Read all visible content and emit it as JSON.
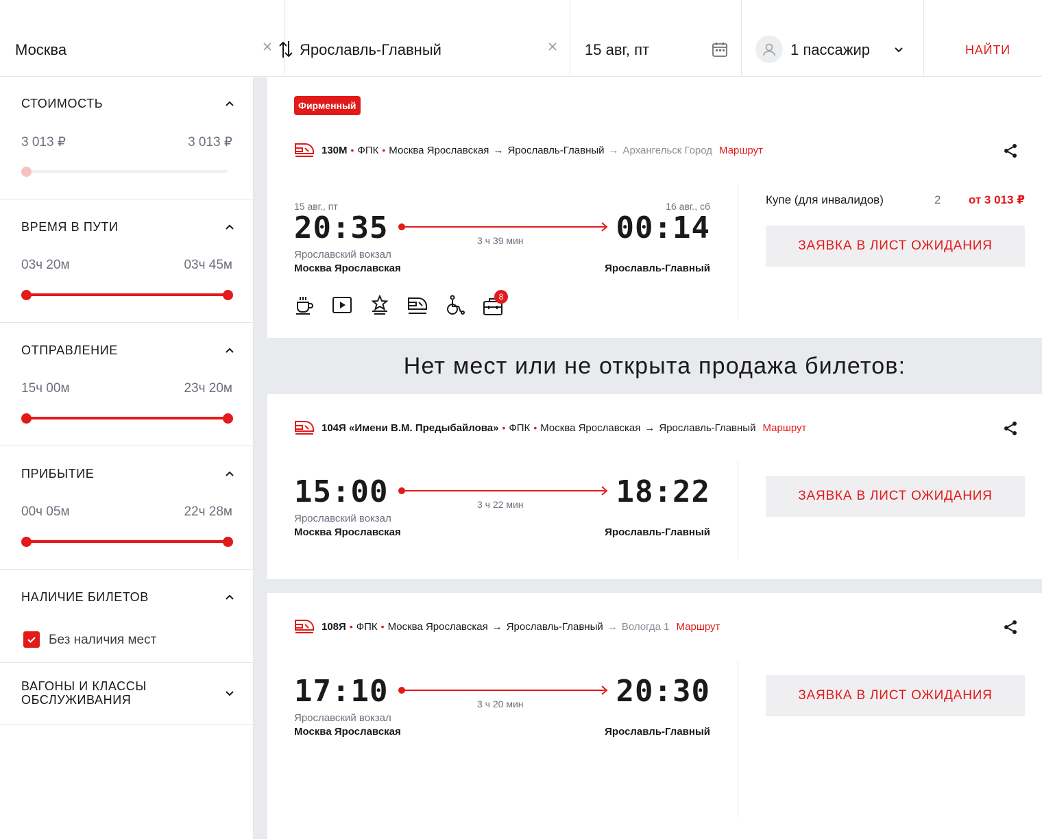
{
  "search": {
    "from": "Москва",
    "to": "Ярославль-Главный",
    "date": "15 авг, пт",
    "passengers": "1 пассажир",
    "find_label": "НАЙТИ"
  },
  "filters": {
    "cost": {
      "title": "СТОИМОСТЬ",
      "min": "3 013 ₽",
      "max": "3 013 ₽"
    },
    "travel_time": {
      "title": "ВРЕМЯ В ПУТИ",
      "min": "03ч 20м",
      "max": "03ч 45м"
    },
    "departure": {
      "title": "ОТПРАВЛЕНИЕ",
      "min": "15ч 00м",
      "max": "23ч 20м"
    },
    "arrival": {
      "title": "ПРИБЫТИЕ",
      "min": "00ч 05м",
      "max": "22ч 28м"
    },
    "availability": {
      "title": "НАЛИЧИЕ БИЛЕТОВ",
      "option": "Без наличия мест",
      "checked": true
    },
    "cars": {
      "title_line1": "ВАГОНЫ И КЛАССЫ",
      "title_line2": "ОБСЛУЖИВАНИЯ"
    }
  },
  "no_seats_message": "Нет мест или не открыта продажа билетов:",
  "trains": [
    {
      "badge": "Фирменный",
      "number": "130М",
      "carrier": "ФПК",
      "from_station": "Москва Ярославская",
      "arrow": "→",
      "to_station": "Ярославль-Главный",
      "extra_arrow": "→",
      "extra_dest": "Архангельск Город",
      "route_link": "Маршрут",
      "dep_date": "15 авг., пт",
      "arr_date": "16 авг., сб",
      "dep_time": "20:35",
      "arr_time": "00:14",
      "duration": "3 ч 39 мин",
      "dep_station_sub": "Ярославский вокзал",
      "dep_station": "Москва Ярославская",
      "arr_station": "Ярославль-Главный",
      "car_class": "Купе (для инвалидов)",
      "seats": "2",
      "price": "от 3 013 ₽",
      "button": "ЗАЯВКА В ЛИСТ ОЖИДАНИЯ",
      "amenities": [
        "coffee-icon",
        "video-icon",
        "award-icon",
        "train-front-icon",
        "wheelchair-icon",
        "luggage-icon"
      ],
      "luggage_badge": "8"
    },
    {
      "number": "104Я «Имени В.М. Предыбайлова»",
      "carrier": "ФПК",
      "from_station": "Москва Ярославская",
      "arrow": "→",
      "to_station": "Ярославль-Главный",
      "route_link": "Маршрут",
      "dep_time": "15:00",
      "arr_time": "18:22",
      "duration": "3 ч 22 мин",
      "dep_station_sub": "Ярославский вокзал",
      "dep_station": "Москва Ярославская",
      "arr_station": "Ярославль-Главный",
      "button": "ЗАЯВКА В ЛИСТ ОЖИДАНИЯ"
    },
    {
      "number": "108Я",
      "carrier": "ФПК",
      "from_station": "Москва Ярославская",
      "arrow": "→",
      "to_station": "Ярославль-Главный",
      "extra_arrow": "→",
      "extra_dest": "Вологда 1",
      "route_link": "Маршрут",
      "dep_time": "17:10",
      "arr_time": "20:30",
      "duration": "3 ч 20 мин",
      "dep_station_sub": "Ярославский вокзал",
      "dep_station": "Москва Ярославская",
      "arr_station": "Ярославль-Главный",
      "button": "ЗАЯВКА В ЛИСТ ОЖИДАНИЯ"
    }
  ],
  "colors": {
    "accent": "#e21a1a",
    "background": "#e9eaee",
    "button_bg": "#efeff1"
  }
}
